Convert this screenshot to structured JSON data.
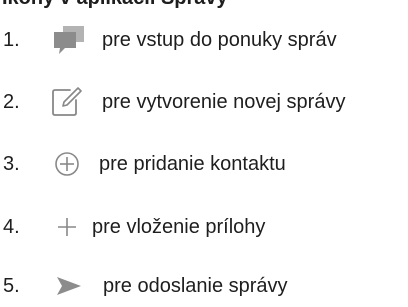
{
  "heading": "Ikony v aplikácii Správy",
  "steps": [
    {
      "number": "1.",
      "icon": "message-bubble-icon",
      "text": "pre vstup do ponuky správ"
    },
    {
      "number": "2.",
      "icon": "compose-icon",
      "text": "pre vytvorenie novej správy"
    },
    {
      "number": "3.",
      "icon": "add-contact-circle-plus-icon",
      "text": "pre pridanie kontaktu"
    },
    {
      "number": "4.",
      "icon": "plus-icon",
      "text": "pre vloženie prílohy"
    },
    {
      "number": "5.",
      "icon": "send-arrow-icon",
      "text": "pre odoslanie správy"
    }
  ],
  "colors": {
    "text": "#1e1e1e",
    "icon_gray": "#888888",
    "bubble_front": "#8c8c8c",
    "bubble_back": "#b3b3b3"
  }
}
